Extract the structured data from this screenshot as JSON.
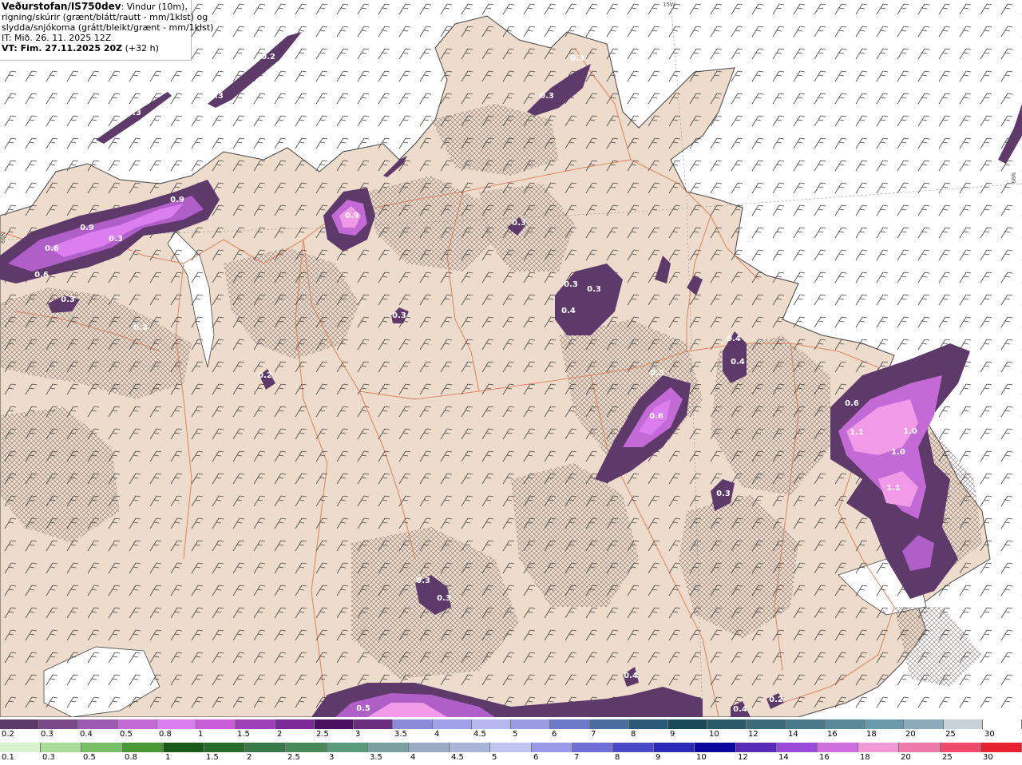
{
  "header": {
    "source": "Veðurstofan/IS750dev",
    "line1_rest": ": Vindur (10m),",
    "line2": "rigning/skúrir (grænt/blátt/rautt - mm/1klst) og",
    "line3": "slydda/snjókoma (grátt/bleikt/grænt - mm/1klst)",
    "line4": "IT: Mið. 26. 11. 2025 12Z",
    "line5_bold": "VT: Fim. 27.11.2025 20Z",
    "line5_rest": " (+32 h)"
  },
  "edge_labels": {
    "top": "15W",
    "right": "66N",
    "left": "66N"
  },
  "value_labels": [
    "0.2",
    "0.3",
    "0.3",
    "0.9",
    "0.9",
    "0.3",
    "0.6",
    "0.6",
    "0.3",
    "0.3",
    "0.9",
    "0.3",
    "0.3",
    "0.2",
    "0.3",
    "0.3",
    "0.3",
    "0.4",
    "0.3",
    "0.4",
    "0.4",
    "0.3",
    "0.6",
    "0.6",
    "1.1",
    "1.0",
    "1.0",
    "1.1",
    "0.3",
    "0.3",
    "0.3",
    "0.3",
    "0.4",
    "0.5",
    "0.4",
    "0.2"
  ],
  "legend_snow": {
    "labels": [
      "0.2",
      "0.3",
      "0.4",
      "0.5",
      "0.8",
      "1",
      "1.5",
      "2",
      "2.5",
      "3",
      "3.5",
      "4",
      "4.5",
      "5",
      "6",
      "7",
      "8",
      "9",
      "10",
      "12",
      "14",
      "16",
      "18",
      "20",
      "25",
      "30"
    ],
    "colors": [
      "#5e3a6b",
      "#7a4a88",
      "#9c5bb0",
      "#c46ad6",
      "#dd7ef0",
      "#c85ed8",
      "#a040b8",
      "#7a2a96",
      "#4a1060",
      "#6a2c7c",
      "#8a8ad8",
      "#a0a0e8",
      "#b8b8f0",
      "#9a9ae0",
      "#6a7ac8",
      "#486ea0",
      "#2a5a78",
      "#1a4a5a",
      "#2a5a6a",
      "#3a6a7a",
      "#4a7a8a",
      "#5a8a9a",
      "#6a9aaa",
      "#8aaaba",
      "#c8d0d8",
      "#ffffff"
    ]
  },
  "legend_rain": {
    "labels": [
      "0.1",
      "0.3",
      "0.5",
      "0.8",
      "1",
      "1.5",
      "2",
      "2.5",
      "3",
      "3.5",
      "4",
      "4.5",
      "5",
      "6",
      "7",
      "8",
      "9",
      "10",
      "12",
      "14",
      "16",
      "18",
      "20",
      "25",
      "30"
    ],
    "colors": [
      "#d8f5d0",
      "#a8dc98",
      "#78c068",
      "#489838",
      "#1a5a1a",
      "#2a6a2a",
      "#3a7a4a",
      "#4a8a5a",
      "#5a9a7a",
      "#7aa0a0",
      "#9aaac0",
      "#aab4d8",
      "#c0c4f0",
      "#9a9ae8",
      "#7070d8",
      "#4a4ac8",
      "#2a2ab8",
      "#0a0aa0",
      "#5a2ab8",
      "#9a4ad8",
      "#d070e0",
      "#f09ad8",
      "#f07aa8",
      "#f04a6a",
      "#e82030"
    ]
  }
}
